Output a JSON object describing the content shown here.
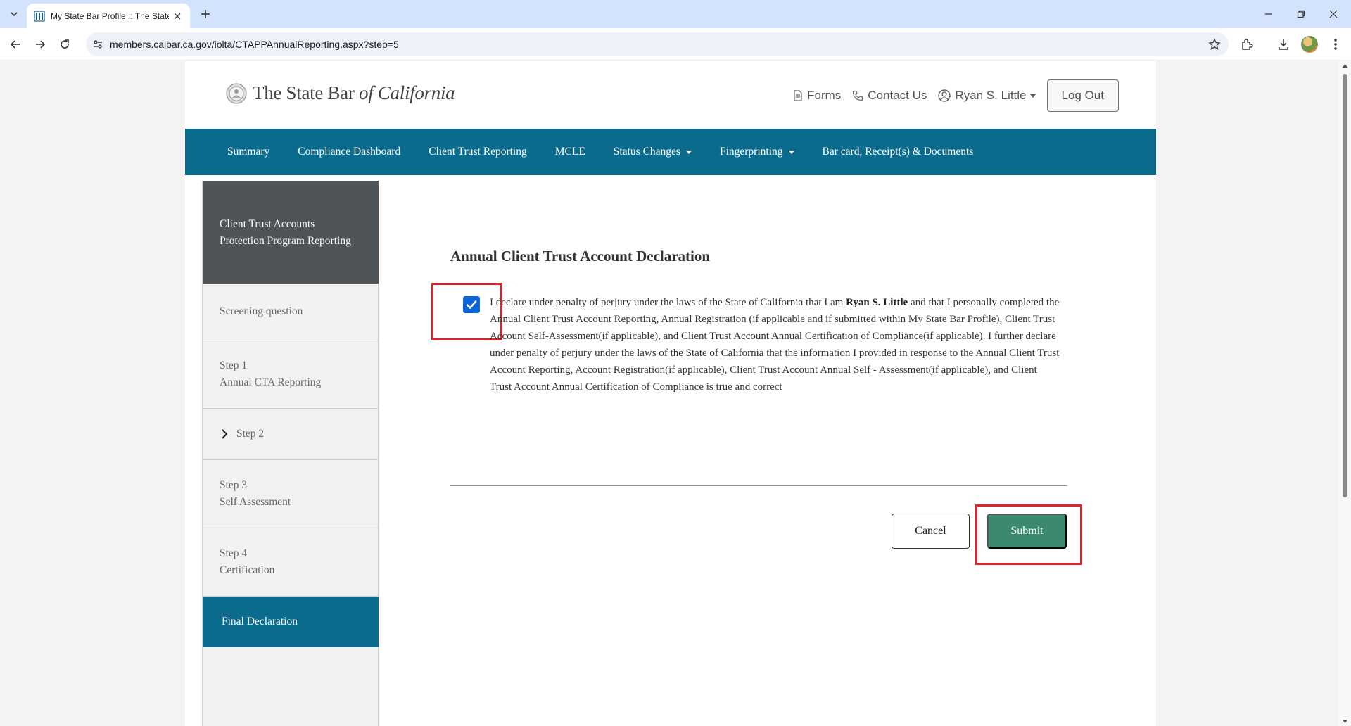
{
  "browser": {
    "tab_title": "My State Bar Profile :: The State Bar of California",
    "url": "members.calbar.ca.gov/iolta/CTAPPAnnualReporting.aspx?step=5"
  },
  "header": {
    "logo_main": "The State Bar ",
    "logo_italic": "of California",
    "forms": "Forms",
    "contact": "Contact Us",
    "user": "Ryan S. Little",
    "logout": "Log Out"
  },
  "nav": {
    "items": [
      "Summary",
      "Compliance Dashboard",
      "Client Trust Reporting",
      "MCLE",
      "Status Changes",
      "Fingerprinting",
      "Bar card, Receipt(s) & Documents"
    ]
  },
  "sidebar": {
    "heading": "Client Trust Accounts Protection Program Reporting",
    "screening": "Screening question",
    "step1_title": "Step 1",
    "step1_sub": "Annual CTA Reporting",
    "step2_title": "Step 2",
    "step3_title": "Step 3",
    "step3_sub": "Self Assessment",
    "step4_title": "Step 4",
    "step4_sub": "Certification",
    "final": "Final Declaration"
  },
  "main": {
    "title": "Annual Client Trust Account Declaration",
    "checkbox_checked": true,
    "decl_before": "I declare under penalty of perjury under the laws of the State of California that I am ",
    "decl_name": "Ryan S. Little",
    "decl_after": " and that I personally completed the Annual Client Trust Account Reporting, Annual Registration (if applicable and if submitted within My State Bar Profile), Client Trust Account Self-Assessment(if applicable), and Client Trust Account Annual Certification of Compliance(if applicable). I further declare under penalty of perjury under the laws of the State of California that the information I provided in response to the Annual Client Trust Account Reporting, Account Registration(if applicable), Client Trust Account Annual Self - Assessment(if applicable), and Client Trust Account Annual Certification of Compliance is true and correct",
    "cancel": "Cancel",
    "submit": "Submit"
  },
  "colors": {
    "nav_bg": "#0b6b8c",
    "submit_bg": "#3c8a6e",
    "highlight": "#d9262b",
    "checkbox": "#0a66d8"
  }
}
